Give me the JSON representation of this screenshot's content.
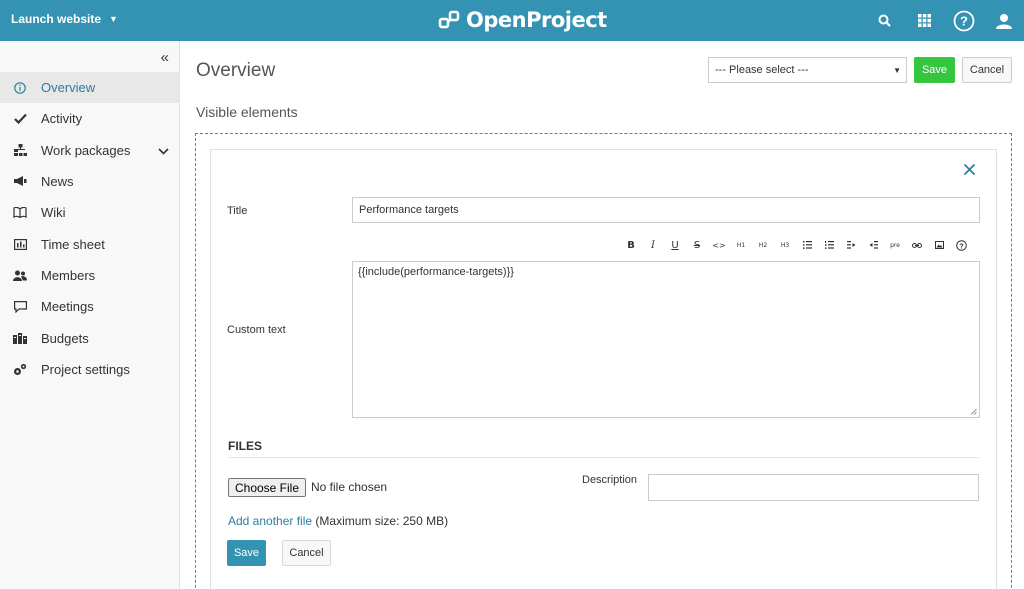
{
  "header": {
    "project_name": "Launch website",
    "logo_text": "OpenProject",
    "icons": [
      "search-icon",
      "modules-grid-icon",
      "help-icon",
      "user-icon"
    ],
    "bg_color": "#3493B3"
  },
  "sidebar": {
    "collapse_label": "«",
    "items": [
      {
        "label": "Overview",
        "icon": "info-icon",
        "active": true
      },
      {
        "label": "Activity",
        "icon": "checkmark-icon"
      },
      {
        "label": "Work packages",
        "icon": "hierarchy-icon",
        "has_children": true
      },
      {
        "label": "News",
        "icon": "megaphone-icon"
      },
      {
        "label": "Wiki",
        "icon": "book-icon"
      },
      {
        "label": "Time sheet",
        "icon": "timesheet-icon"
      },
      {
        "label": "Members",
        "icon": "members-icon"
      },
      {
        "label": "Meetings",
        "icon": "meeting-icon"
      },
      {
        "label": "Budgets",
        "icon": "budget-icon"
      },
      {
        "label": "Project settings",
        "icon": "settings-icon"
      }
    ]
  },
  "main": {
    "title": "Overview",
    "select_placeholder": "--- Please select ---",
    "save_label": "Save",
    "cancel_label": "Cancel",
    "section_label": "Visible elements"
  },
  "widget": {
    "title_label": "Title",
    "title_value": "Performance targets",
    "custom_text_label": "Custom text",
    "editor_content": "{{include(performance-targets)}}",
    "toolbar": [
      "B",
      "I",
      "U",
      "S",
      "<>",
      "H1",
      "H2",
      "H3",
      "ul",
      "ol",
      "indent",
      "outdent",
      "pre",
      "link",
      "image",
      "?"
    ],
    "files_heading": "FILES",
    "choose_file_label": "Choose File",
    "no_file_text": "No file chosen",
    "description_label": "Description",
    "add_another_file": "Add another file",
    "max_size_text": "(Maximum size: 250 MB)",
    "save_label": "Save",
    "cancel_label": "Cancel"
  },
  "colors": {
    "accent": "#3493B3",
    "save_green": "#35c53f",
    "link": "#2a7ea0"
  }
}
